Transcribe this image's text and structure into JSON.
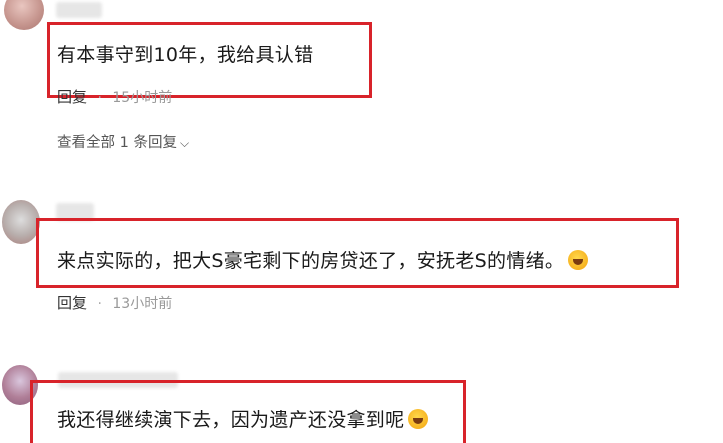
{
  "comments": [
    {
      "text": "有本事守到10年，我给具认错",
      "reply_label": "回复",
      "time": "15小时前"
    },
    {
      "text": "来点实际的，把大S豪宅剩下的房贷还了，安抚老S的情绪。",
      "emoji": "laughing-crying-emoji",
      "reply_label": "回复",
      "time": "13小时前"
    },
    {
      "text": "我还得继续演下去，因为遗产还没拿到呢",
      "emoji": "laughing-crying-emoji"
    }
  ],
  "view_all": {
    "label": "查看全部 1 条回复",
    "icon": "chevron-down-icon"
  },
  "colors": {
    "highlight_box": "#d8232a",
    "meta_text": "#999999"
  }
}
